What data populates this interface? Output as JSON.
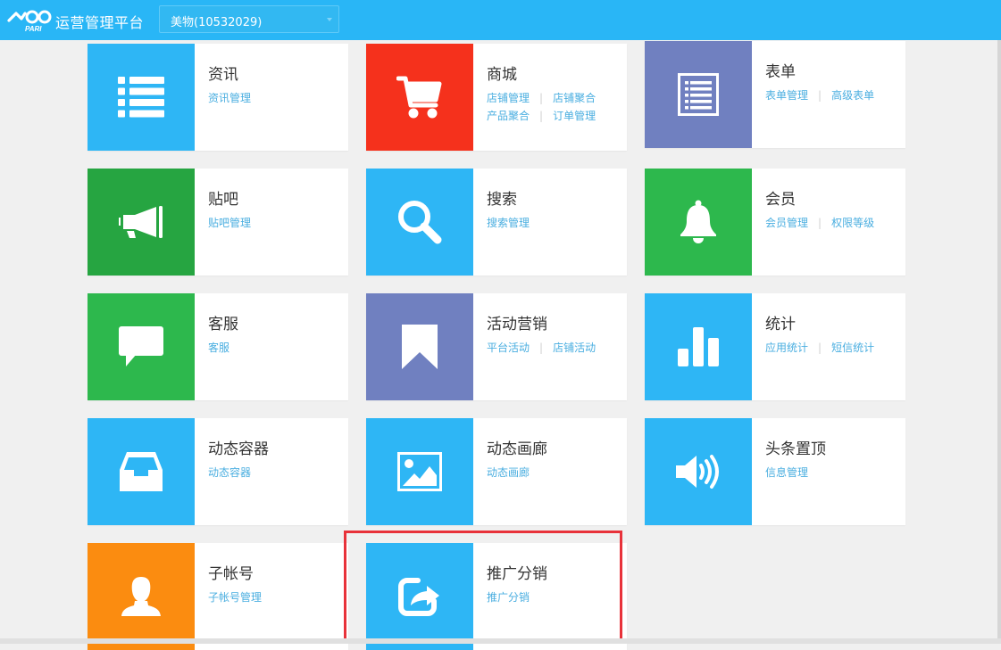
{
  "header": {
    "platform_title": "运营管理平台",
    "account_select": "美物(10532029)",
    "logo_icon": "yoo-pari-logo"
  },
  "colors": {
    "topbar": "#29b6f6",
    "blue": "#2eb6f5",
    "red": "#f5311c",
    "purple": "#7080c0",
    "green": "#2db84d",
    "darkgreen": "#26a541",
    "orange": "#fb8c10",
    "highlight": "#e8323a"
  },
  "tiles": [
    {
      "title": "资讯",
      "icon": "list-icon",
      "color": "blue",
      "links": [
        [
          "资讯管理"
        ]
      ]
    },
    {
      "title": "商城",
      "icon": "cart-icon",
      "color": "red",
      "links": [
        [
          "店铺管理",
          "店铺聚合"
        ],
        [
          "产品聚合",
          "订单管理"
        ]
      ]
    },
    {
      "title": "表单",
      "icon": "form-icon",
      "color": "purple",
      "links": [
        [
          "表单管理",
          "高级表单"
        ]
      ]
    },
    {
      "title": "贴吧",
      "icon": "megaphone-icon",
      "color": "darkgreen",
      "links": [
        [
          "贴吧管理"
        ]
      ]
    },
    {
      "title": "搜索",
      "icon": "search-icon",
      "color": "blue",
      "links": [
        [
          "搜索管理"
        ]
      ]
    },
    {
      "title": "会员",
      "icon": "bell-icon",
      "color": "green",
      "links": [
        [
          "会员管理",
          "权限等级"
        ]
      ]
    },
    {
      "title": "客服",
      "icon": "chat-icon",
      "color": "green",
      "links": [
        [
          "客服"
        ]
      ]
    },
    {
      "title": "活动营销",
      "icon": "bookmark-icon",
      "color": "purple",
      "links": [
        [
          "平台活动",
          "店铺活动"
        ]
      ]
    },
    {
      "title": "统计",
      "icon": "bar-chart-icon",
      "color": "blue",
      "links": [
        [
          "应用统计",
          "短信统计"
        ]
      ]
    },
    {
      "title": "动态容器",
      "icon": "inbox-icon",
      "color": "blue",
      "links": [
        [
          "动态容器"
        ]
      ]
    },
    {
      "title": "动态画廊",
      "icon": "image-icon",
      "color": "blue",
      "links": [
        [
          "动态画廊"
        ]
      ]
    },
    {
      "title": "头条置顶",
      "icon": "speaker-icon",
      "color": "blue",
      "links": [
        [
          "信息管理"
        ]
      ]
    },
    {
      "title": "子帐号",
      "icon": "user-icon",
      "color": "orange",
      "links": [
        [
          "子帐号管理"
        ]
      ]
    },
    {
      "title": "推广分销",
      "icon": "share-icon",
      "color": "blue",
      "links": [
        [
          "推广分销"
        ]
      ]
    }
  ]
}
